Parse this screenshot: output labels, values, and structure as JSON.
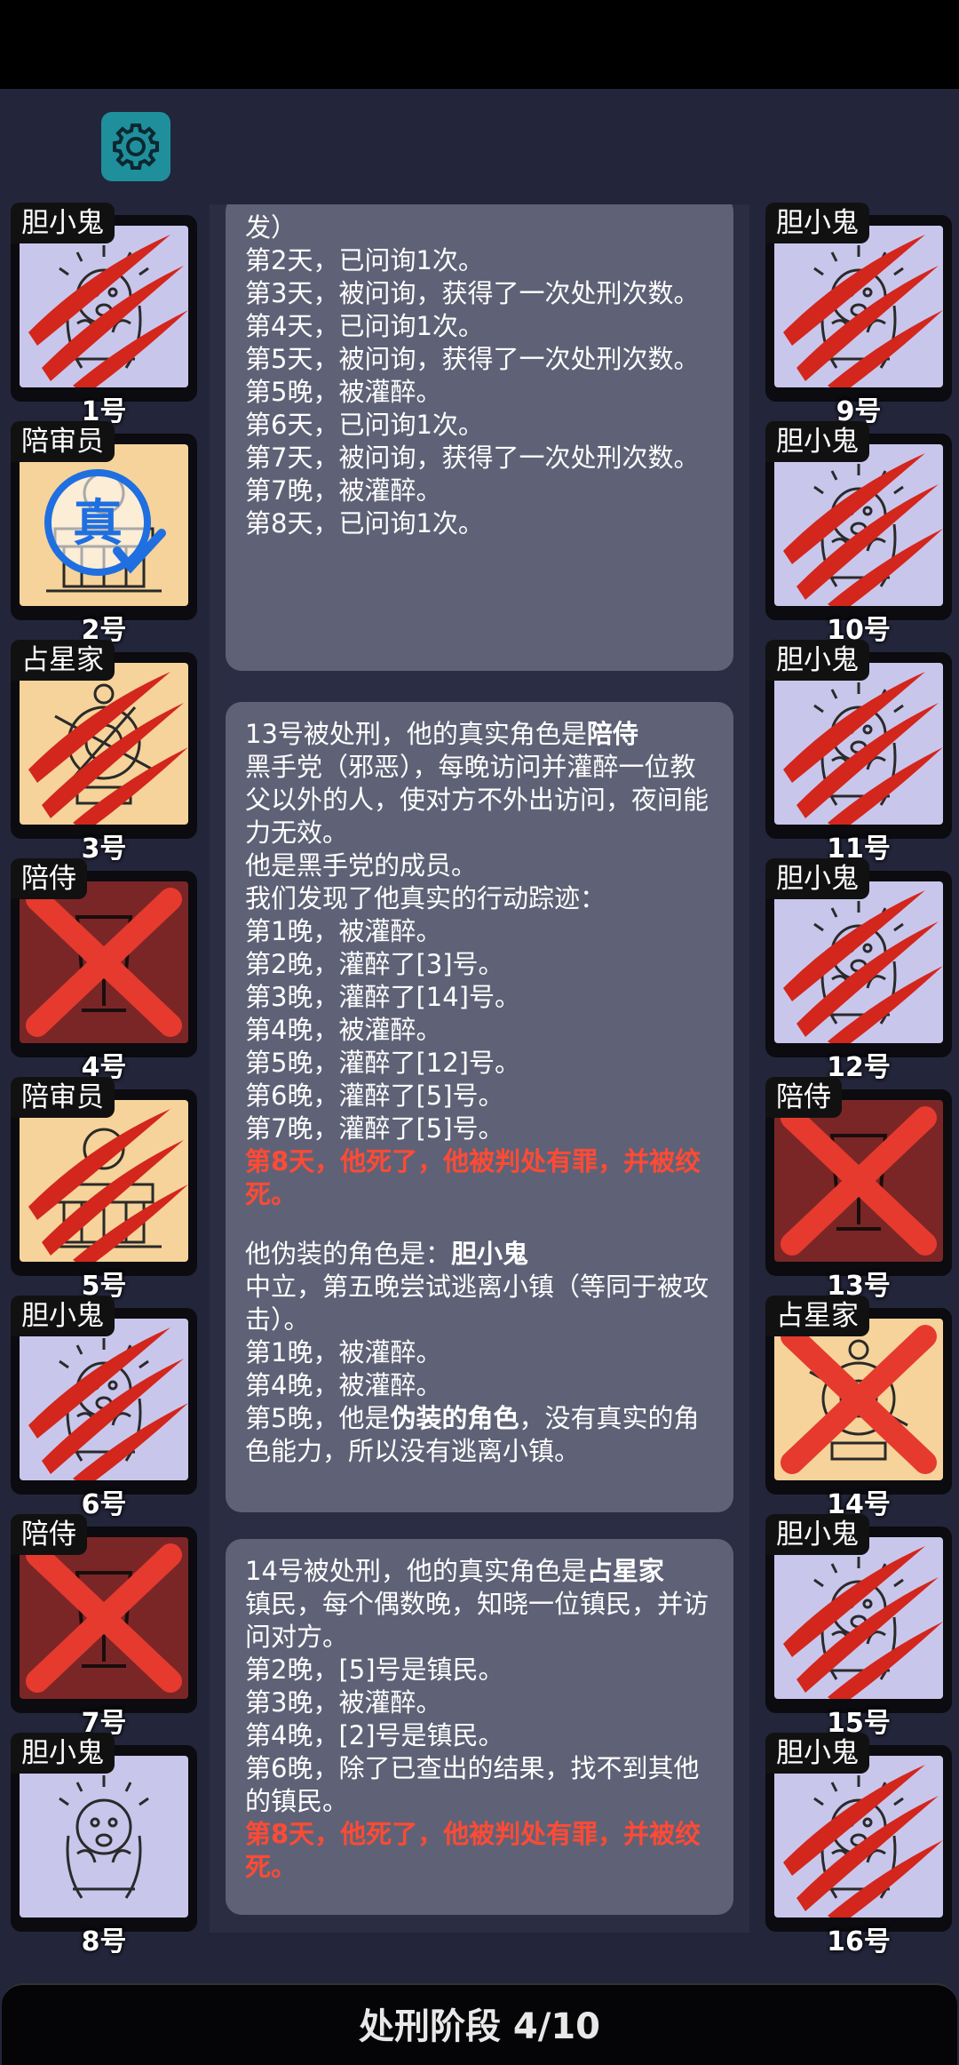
{
  "header": {
    "settings_icon": "gear-icon"
  },
  "players_left": [
    {
      "role": "胆小鬼",
      "num": "1号",
      "bg": "lav",
      "state": "claw",
      "fig": "scared"
    },
    {
      "role": "陪审员",
      "num": "2号",
      "bg": "peach",
      "state": "stamp",
      "fig": "bench",
      "stamp": "真"
    },
    {
      "role": "占星家",
      "num": "3号",
      "bg": "peach",
      "state": "claw",
      "fig": "astro"
    },
    {
      "role": "陪侍",
      "num": "4号",
      "bg": "maroon",
      "state": "x",
      "fig": "chair"
    },
    {
      "role": "陪审员",
      "num": "5号",
      "bg": "peach",
      "state": "claw",
      "fig": "bench"
    },
    {
      "role": "胆小鬼",
      "num": "6号",
      "bg": "lav",
      "state": "claw",
      "fig": "scared"
    },
    {
      "role": "陪侍",
      "num": "7号",
      "bg": "maroon",
      "state": "x",
      "fig": "chair"
    },
    {
      "role": "胆小鬼",
      "num": "8号",
      "bg": "lav",
      "state": "none",
      "fig": "scared"
    }
  ],
  "players_right": [
    {
      "role": "胆小鬼",
      "num": "9号",
      "bg": "lav",
      "state": "claw",
      "fig": "scared"
    },
    {
      "role": "胆小鬼",
      "num": "10号",
      "bg": "lav",
      "state": "claw",
      "fig": "scared"
    },
    {
      "role": "胆小鬼",
      "num": "11号",
      "bg": "lav",
      "state": "claw",
      "fig": "scared"
    },
    {
      "role": "胆小鬼",
      "num": "12号",
      "bg": "lav",
      "state": "claw",
      "fig": "scared"
    },
    {
      "role": "陪侍",
      "num": "13号",
      "bg": "maroon",
      "state": "x",
      "fig": "chair"
    },
    {
      "role": "占星家",
      "num": "14号",
      "bg": "peach",
      "state": "x",
      "fig": "astro"
    },
    {
      "role": "胆小鬼",
      "num": "15号",
      "bg": "lav",
      "state": "claw",
      "fig": "scared"
    },
    {
      "role": "胆小鬼",
      "num": "16号",
      "bg": "lav",
      "state": "claw",
      "fig": "scared"
    }
  ],
  "log": [
    {
      "lines": [
        {
          "t": "发）"
        },
        {
          "t": "第2天，已问询1次。"
        },
        {
          "t": "第3天，被问询，获得了一次处刑次数。"
        },
        {
          "t": "第4天，已问询1次。"
        },
        {
          "t": "第5天，被问询，获得了一次处刑次数。"
        },
        {
          "t": "第5晚，被灌醉。"
        },
        {
          "t": "第6天，已问询1次。"
        },
        {
          "t": "第7天，被问询，获得了一次处刑次数。"
        },
        {
          "t": "第7晚，被灌醉。"
        },
        {
          "t": "第8天，已问询1次。"
        }
      ]
    },
    {
      "lines": [
        {
          "t": "13号被处刑，他的真实角色是",
          "b": "陪侍"
        },
        {
          "t": "黑手党（邪恶），每晚访问并灌醉一位教父以外的人，使对方不外出访问，夜间能力无效。"
        },
        {
          "t": "他是黑手党的成员。"
        },
        {
          "t": "我们发现了他真实的行动踪迹："
        },
        {
          "t": "第1晚，被灌醉。"
        },
        {
          "t": "第2晚，灌醉了[3]号。"
        },
        {
          "t": "第3晚，灌醉了[14]号。"
        },
        {
          "t": "第4晚，被灌醉。"
        },
        {
          "t": "第5晚，灌醉了[12]号。"
        },
        {
          "t": "第6晚，灌醉了[5]号。"
        },
        {
          "t": "第7晚，灌醉了[5]号。"
        },
        {
          "t": "第8天，他死了，他被判处有罪，并被绞死。",
          "red": true
        },
        {
          "t": "",
          "blank": true
        },
        {
          "t": "他伪装的角色是：",
          "b": "胆小鬼"
        },
        {
          "t": "中立，第五晚尝试逃离小镇（等同于被攻击）。"
        },
        {
          "t": "第1晚，被灌醉。"
        },
        {
          "t": "第4晚，被灌醉。"
        },
        {
          "t": "第5晚，他是",
          "b": "伪装的角色",
          "t2": "，没有真实的角色能力，所以没有逃离小镇。"
        }
      ]
    },
    {
      "lines": [
        {
          "t": "14号被处刑，他的真实角色是",
          "b": "占星家"
        },
        {
          "t": "镇民，每个偶数晚，知晓一位镇民，并访问对方。"
        },
        {
          "t": "第2晚，[5]号是镇民。"
        },
        {
          "t": "第3晚，被灌醉。"
        },
        {
          "t": "第4晚，[2]号是镇民。"
        },
        {
          "t": "第6晚，除了已查出的结果，找不到其他的镇民。"
        },
        {
          "t": "第8天，他死了，他被判处有罪，并被绞死。",
          "red": true
        }
      ]
    }
  ],
  "footer": {
    "phase_label": "处刑阶段 4/10"
  },
  "colors": {
    "accent_red": "#ff4a35",
    "gear_bg": "#1f8f9c",
    "panel": "#5f6276"
  }
}
